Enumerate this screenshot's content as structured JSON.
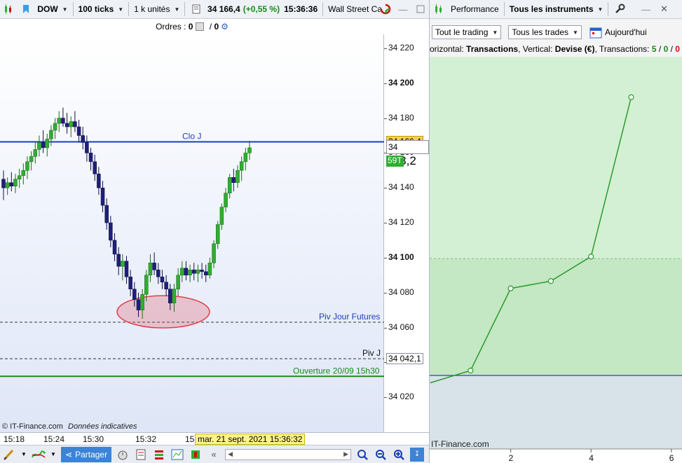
{
  "toolbar": {
    "instrument": "DOW",
    "ticks": "100 ticks",
    "units": "1 k unités",
    "price": "34 166,4",
    "change": "(+0,55 %)",
    "time": "15:36:36",
    "market": "Wall Street Ca"
  },
  "orders": {
    "label": "Ordres :",
    "count_a": "0",
    "sep": "/",
    "count_b": "0"
  },
  "price_axis": {
    "ticks": [
      "34 220",
      "34 200",
      "34 180",
      "34 160",
      "34 140",
      "34 120",
      "34 100",
      "34 080",
      "34 060",
      "34 040",
      "34 020"
    ],
    "current_price": "34 166,4",
    "cursor_price_a": "34 1",
    "cursor_price_b": "63,2",
    "tick_count": "59T",
    "piv_price": "34 042,1"
  },
  "lines": {
    "clo": "Clo J",
    "piv_futures": "Piv Jour Futures",
    "piv": "Piv J",
    "ouverture": "Ouverture 20/09 15h30"
  },
  "chart_footer": {
    "source": "© IT-Finance.com",
    "note": "Données indicatives"
  },
  "time_axis": {
    "labels": [
      "15:18",
      "15:24",
      "15:30",
      "15:32",
      "15"
    ],
    "cursor_date": "mar. 21 sept. 2021 15:36:32"
  },
  "bottom_bar": {
    "share": "Partager"
  },
  "right_toolbar": {
    "performance": "Performance",
    "instruments": "Tous les instruments"
  },
  "right_controls": {
    "trading": "Tout le trading",
    "trades": "Tous les trades",
    "today": "Aujourd'hui"
  },
  "perf_header": {
    "prefix": "orizontal:",
    "h_value": "Transactions",
    "sep1": ", Vertical:",
    "v_value": "Devise (€)",
    "sep2": ", Transactions:",
    "n1": "5",
    "slash1": " / ",
    "n2": "0",
    "slash2": " / ",
    "n3": "0"
  },
  "perf_footer": {
    "source": "IT-Finance.com"
  },
  "colors": {
    "up_candle": "#2fae2f",
    "down_candle": "#1f1f7a",
    "clo_line": "#1b3fb3",
    "ouverture_line": "#1a8a1a",
    "highlight_ellipse": "#e0404a",
    "perf_line": "#2b9a2b",
    "perf_fill_top": "#c9ecc9",
    "perf_fill_bottom": "#d6e4e4"
  },
  "chart_data": [
    {
      "type": "candlestick",
      "title": "DOW 100 ticks",
      "ylim": [
        34000,
        34228
      ],
      "candles": [
        [
          34145,
          34150,
          34133,
          34140
        ],
        [
          34140,
          34146,
          34136,
          34143
        ],
        [
          34143,
          34149,
          34138,
          34141
        ],
        [
          34141,
          34148,
          34137,
          34145
        ],
        [
          34145,
          34151,
          34140,
          34147
        ],
        [
          34147,
          34154,
          34142,
          34150
        ],
        [
          34150,
          34158,
          34145,
          34155
        ],
        [
          34155,
          34161,
          34150,
          34158
        ],
        [
          34158,
          34166,
          34154,
          34162
        ],
        [
          34162,
          34170,
          34158,
          34166
        ],
        [
          34166,
          34173,
          34160,
          34163
        ],
        [
          34163,
          34171,
          34158,
          34168
        ],
        [
          34168,
          34176,
          34164,
          34173
        ],
        [
          34173,
          34180,
          34168,
          34177
        ],
        [
          34177,
          34184,
          34172,
          34180
        ],
        [
          34180,
          34186,
          34175,
          34177
        ],
        [
          34177,
          34183,
          34171,
          34175
        ],
        [
          34175,
          34181,
          34169,
          34178
        ],
        [
          34178,
          34184,
          34172,
          34175
        ],
        [
          34175,
          34179,
          34166,
          34170
        ],
        [
          34170,
          34175,
          34162,
          34166
        ],
        [
          34166,
          34170,
          34155,
          34160
        ],
        [
          34160,
          34163,
          34150,
          34155
        ],
        [
          34155,
          34159,
          34144,
          34148
        ],
        [
          34148,
          34152,
          34136,
          34140
        ],
        [
          34140,
          34144,
          34126,
          34130
        ],
        [
          34130,
          34134,
          34116,
          34120
        ],
        [
          34120,
          34124,
          34106,
          34110
        ],
        [
          34110,
          34114,
          34098,
          34102
        ],
        [
          34102,
          34106,
          34090,
          34095
        ],
        [
          34095,
          34102,
          34087,
          34098
        ],
        [
          34098,
          34101,
          34085,
          34089
        ],
        [
          34089,
          34093,
          34078,
          34082
        ],
        [
          34082,
          34086,
          34072,
          34076
        ],
        [
          34076,
          34080,
          34066,
          34070
        ],
        [
          34070,
          34082,
          34065,
          34079
        ],
        [
          34079,
          34093,
          34075,
          34090
        ],
        [
          34090,
          34102,
          34086,
          34097
        ],
        [
          34097,
          34103,
          34090,
          34093
        ],
        [
          34093,
          34097,
          34085,
          34089
        ],
        [
          34089,
          34093,
          34082,
          34086
        ],
        [
          34086,
          34090,
          34078,
          34082
        ],
        [
          34082,
          34085,
          34070,
          34074
        ],
        [
          34074,
          34085,
          34069,
          34082
        ],
        [
          34082,
          34094,
          34078,
          34090
        ],
        [
          34090,
          34098,
          34086,
          34094
        ],
        [
          34094,
          34098,
          34087,
          34090
        ],
        [
          34090,
          34096,
          34086,
          34093
        ],
        [
          34093,
          34097,
          34087,
          34091
        ],
        [
          34091,
          34096,
          34086,
          34093
        ],
        [
          34093,
          34097,
          34088,
          34092
        ],
        [
          34092,
          34096,
          34086,
          34090
        ],
        [
          34090,
          34100,
          34088,
          34097
        ],
        [
          34097,
          34110,
          34094,
          34108
        ],
        [
          34108,
          34121,
          34105,
          34119
        ],
        [
          34119,
          34131,
          34116,
          34129
        ],
        [
          34129,
          34140,
          34126,
          34137
        ],
        [
          34137,
          34148,
          34134,
          34146
        ],
        [
          34146,
          34151,
          34138,
          34143
        ],
        [
          34143,
          34153,
          34140,
          34150
        ],
        [
          34150,
          34158,
          34144,
          34155
        ],
        [
          34155,
          34163,
          34150,
          34160
        ],
        [
          34160,
          34167,
          34156,
          34163
        ]
      ],
      "reference_lines": [
        {
          "name": "Clo J",
          "value": 34166.4
        },
        {
          "name": "Piv Jour Futures",
          "value": 34063
        },
        {
          "name": "Piv J",
          "value": 34042.1
        },
        {
          "name": "Ouverture 20/09 15h30",
          "value": 34032
        }
      ]
    },
    {
      "type": "line",
      "xlabel": "Transactions",
      "ylabel": "Devise (€)",
      "x": [
        0,
        1,
        2,
        3,
        4,
        5
      ],
      "y": [
        -6,
        4,
        71,
        77,
        97,
        227
      ],
      "xlim": [
        0,
        6.3
      ],
      "ylim": [
        -60,
        260
      ],
      "xticks": [
        2,
        4,
        6
      ]
    }
  ]
}
